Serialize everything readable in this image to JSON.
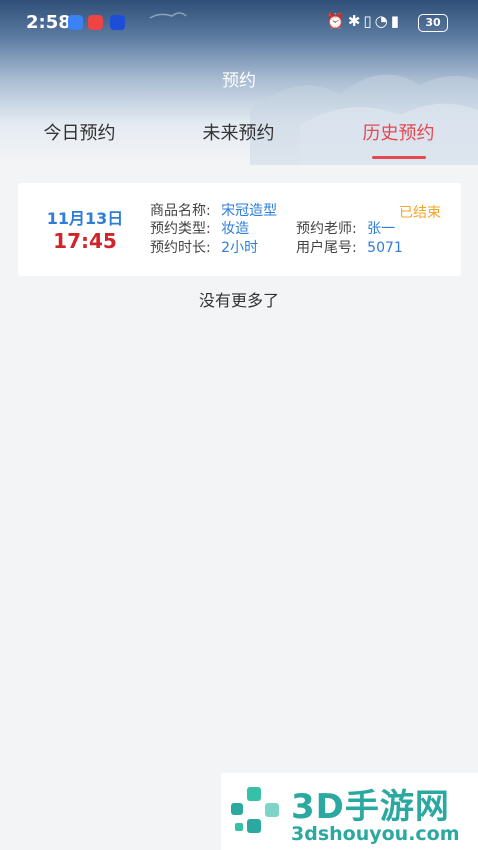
{
  "status_bar": {
    "time": "2:58",
    "system_icons": "⏰✱▯◔▮",
    "battery": "30"
  },
  "header": {
    "title": "预约"
  },
  "tabs": [
    {
      "label": "今日预约",
      "active": false
    },
    {
      "label": "未来预约",
      "active": false
    },
    {
      "label": "历史预约",
      "active": true
    }
  ],
  "colors": {
    "accent": "#e5484d",
    "link": "#2d7ed9",
    "warning": "#f5a623"
  },
  "appointments": [
    {
      "date": "11月13日",
      "time": "17:45",
      "product_label": "商品名称:",
      "product_value": "宋冠造型",
      "type_label": "预约类型:",
      "type_value": "妆造",
      "teacher_label": "预约老师:",
      "teacher_value": "张一",
      "duration_label": "预约时长:",
      "duration_value": "2小时",
      "tail_label": "用户尾号:",
      "tail_value": "5071",
      "status": "已结束"
    }
  ],
  "list_footer": "没有更多了",
  "watermark": {
    "big": "3D手游网",
    "small": "3dshouyou.com"
  }
}
